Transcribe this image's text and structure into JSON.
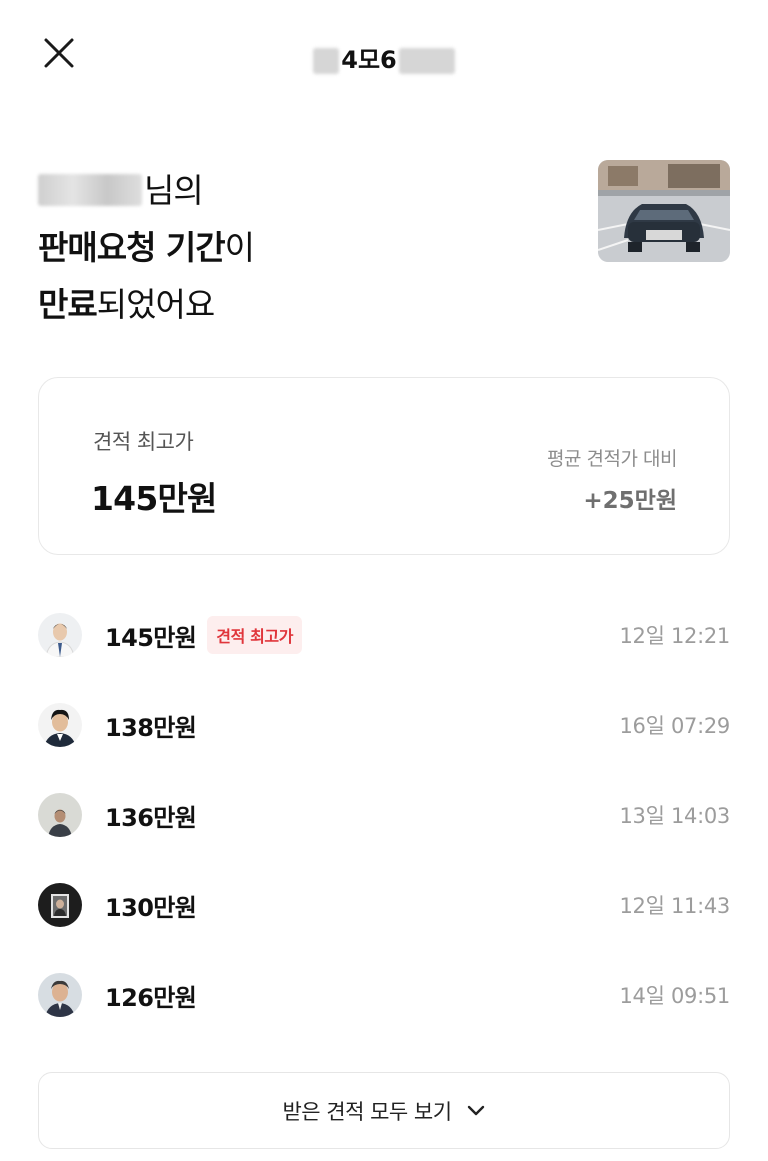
{
  "header": {
    "title_visible": "4모6"
  },
  "headline": {
    "line1_suffix": "님의",
    "line2_bold": "판매요청 기간",
    "line2_rest": "이",
    "line3_bold": "만료",
    "line3_rest": "되었어요"
  },
  "summary": {
    "top_label": "견적 최고가",
    "top_value": "145만원",
    "compare_label": "평균 견적가 대비",
    "compare_value": "+25만원"
  },
  "bids": [
    {
      "amount": "145만원",
      "badge": "견적 최고가",
      "time": "12일 12:21"
    },
    {
      "amount": "138만원",
      "badge": "",
      "time": "16일 07:29"
    },
    {
      "amount": "136만원",
      "badge": "",
      "time": "13일 14:03"
    },
    {
      "amount": "130만원",
      "badge": "",
      "time": "12일 11:43"
    },
    {
      "amount": "126만원",
      "badge": "",
      "time": "14일 09:51"
    }
  ],
  "view_all": {
    "label": "받은 견적 모두 보기"
  },
  "colors": {
    "badge_text": "#e0353b",
    "badge_bg": "#fdeeee",
    "muted_text": "#9c9c9c"
  },
  "icons": {
    "close": "close-icon",
    "chevron": "chevron-down-icon"
  }
}
